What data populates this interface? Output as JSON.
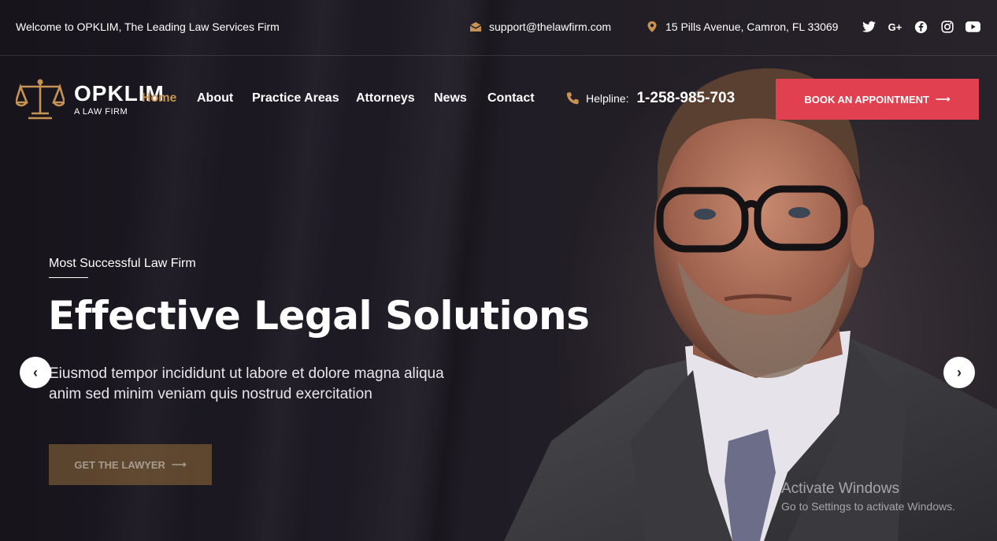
{
  "topbar": {
    "welcome": "Welcome to OPKLIM, The Leading Law Services Firm",
    "email": "support@thelawfirm.com",
    "address": "15 Pills Avenue, Camron, FL 33069",
    "socials": [
      "twitter-icon",
      "google-plus-icon",
      "facebook-icon",
      "instagram-icon",
      "youtube-icon"
    ]
  },
  "brand": {
    "name": "OPKLIM",
    "tagline": "A LAW FIRM"
  },
  "nav": {
    "items": [
      "Home",
      "About",
      "Practice Areas",
      "Attorneys",
      "News",
      "Contact"
    ],
    "active": "Home"
  },
  "helpline": {
    "label": "Helpline:",
    "number": "1-258-985-703"
  },
  "book_button": "BOOK AN APPOINTMENT",
  "hero": {
    "eyebrow": "Most Successful Law Firm",
    "headline": "Effective Legal Solutions",
    "desc_line1": "Eiusmod tempor incididunt ut labore et dolore magna aliqua",
    "desc_line2": "anim sed minim veniam quis nostrud exercitation",
    "cta": "GET THE LAWYER"
  },
  "watermark": {
    "title": "Activate Windows",
    "subtitle": "Go to Settings to activate Windows."
  },
  "colors": {
    "accent": "#c79355",
    "book": "#e0404f"
  }
}
